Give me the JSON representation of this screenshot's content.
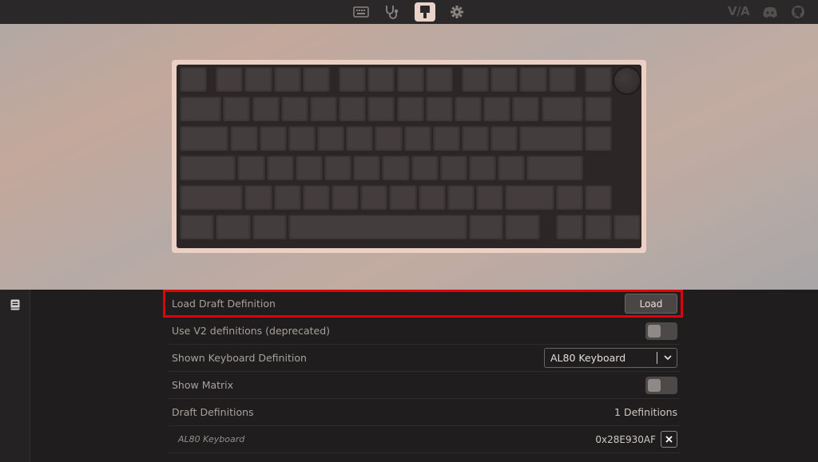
{
  "nav": {
    "icons": [
      "keyboard-icon",
      "stethoscope-icon",
      "paintbrush-icon",
      "gear-icon"
    ],
    "active": "paintbrush-icon",
    "brand": "V/A",
    "right_icons": [
      "discord-icon",
      "github-icon"
    ]
  },
  "colors": {
    "case": "#ecd0c3",
    "keycap": "#3b3736",
    "highlight": "#e0000b"
  },
  "settings": {
    "load_draft": {
      "label": "Load Draft Definition",
      "button": "Load"
    },
    "use_v2": {
      "label": "Use V2 definitions (deprecated)",
      "enabled": false
    },
    "shown_definition": {
      "label": "Shown Keyboard Definition",
      "value": "AL80 Keyboard"
    },
    "show_matrix": {
      "label": "Show Matrix",
      "enabled": false
    },
    "draft_definitions": {
      "label": "Draft Definitions",
      "value": "1 Definitions"
    },
    "draft_item": {
      "name": "AL80 Keyboard",
      "id": "0x28E930AF"
    }
  }
}
